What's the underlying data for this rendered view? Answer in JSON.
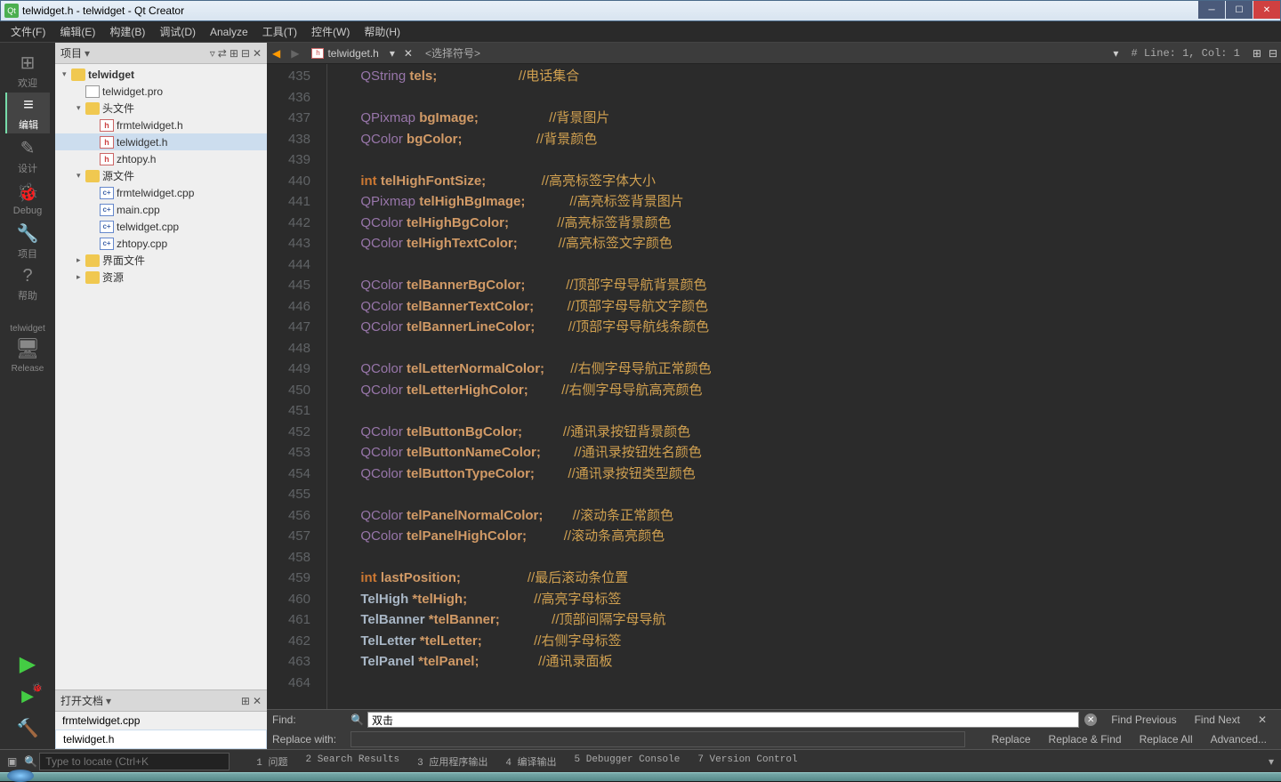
{
  "window": {
    "title": "telwidget.h - telwidget - Qt Creator"
  },
  "menu": [
    "文件(F)",
    "编辑(E)",
    "构建(B)",
    "调试(D)",
    "Analyze",
    "工具(T)",
    "控件(W)",
    "帮助(H)"
  ],
  "iconbar": {
    "items": [
      {
        "icon": "⊞",
        "label": "欢迎"
      },
      {
        "icon": "≡",
        "label": "编辑",
        "active": true
      },
      {
        "icon": "✎",
        "label": "设计"
      },
      {
        "icon": "🐞",
        "label": "Debug"
      },
      {
        "icon": "🔧",
        "label": "项目"
      },
      {
        "icon": "?",
        "label": "帮助"
      }
    ],
    "target": "telwidget",
    "release": "Release"
  },
  "sidebar": {
    "header": "项目",
    "tree": [
      {
        "depth": 0,
        "toggle": "▾",
        "icon": "folder",
        "label": "telwidget",
        "bold": true
      },
      {
        "depth": 1,
        "toggle": "",
        "icon": "pro",
        "label": "telwidget.pro"
      },
      {
        "depth": 1,
        "toggle": "▾",
        "icon": "folder",
        "label": "头文件"
      },
      {
        "depth": 2,
        "toggle": "",
        "icon": "h",
        "label": "frmtelwidget.h"
      },
      {
        "depth": 2,
        "toggle": "",
        "icon": "h",
        "label": "telwidget.h",
        "sel": true
      },
      {
        "depth": 2,
        "toggle": "",
        "icon": "h",
        "label": "zhtopy.h"
      },
      {
        "depth": 1,
        "toggle": "▾",
        "icon": "folder",
        "label": "源文件"
      },
      {
        "depth": 2,
        "toggle": "",
        "icon": "cpp",
        "label": "frmtelwidget.cpp"
      },
      {
        "depth": 2,
        "toggle": "",
        "icon": "cpp",
        "label": "main.cpp"
      },
      {
        "depth": 2,
        "toggle": "",
        "icon": "cpp",
        "label": "telwidget.cpp"
      },
      {
        "depth": 2,
        "toggle": "",
        "icon": "cpp",
        "label": "zhtopy.cpp"
      },
      {
        "depth": 1,
        "toggle": "▸",
        "icon": "folder",
        "label": "界面文件"
      },
      {
        "depth": 1,
        "toggle": "▸",
        "icon": "folder",
        "label": "资源"
      }
    ],
    "openfiles": {
      "header": "打开文档",
      "items": [
        "frmtelwidget.cpp",
        "telwidget.h"
      ],
      "sel": 1
    }
  },
  "editor": {
    "filename": "telwidget.h",
    "symbol": "<选择符号>",
    "lineinfo": "#  Line: 1, Col: 1",
    "startLine": 435,
    "lines": [
      {
        "t": "QString",
        "v": "tels;",
        "c": "//电话集合"
      },
      {
        "blank": true
      },
      {
        "t": "QPixmap",
        "v": "bgImage;",
        "c": "//背景图片"
      },
      {
        "t": "QColor",
        "v": "bgColor;",
        "c": "//背景颜色"
      },
      {
        "blank": true
      },
      {
        "t": "int",
        "kw": true,
        "v": "telHighFontSize;",
        "c": "//高亮标签字体大小"
      },
      {
        "t": "QPixmap",
        "v": "telHighBgImage;",
        "c": "//高亮标签背景图片"
      },
      {
        "t": "QColor",
        "v": "telHighBgColor;",
        "c": "//高亮标签背景颜色"
      },
      {
        "t": "QColor",
        "v": "telHighTextColor;",
        "c": "//高亮标签文字颜色"
      },
      {
        "blank": true
      },
      {
        "t": "QColor",
        "v": "telBannerBgColor;",
        "c": "//顶部字母导航背景颜色"
      },
      {
        "t": "QColor",
        "v": "telBannerTextColor;",
        "c": "//顶部字母导航文字颜色"
      },
      {
        "t": "QColor",
        "v": "telBannerLineColor;",
        "c": "//顶部字母导航线条颜色"
      },
      {
        "blank": true
      },
      {
        "t": "QColor",
        "v": "telLetterNormalColor;",
        "c": "//右侧字母导航正常颜色"
      },
      {
        "t": "QColor",
        "v": "telLetterHighColor;",
        "c": "//右侧字母导航高亮颜色"
      },
      {
        "blank": true
      },
      {
        "t": "QColor",
        "v": "telButtonBgColor;",
        "c": "//通讯录按钮背景颜色"
      },
      {
        "t": "QColor",
        "v": "telButtonNameColor;",
        "c": "//通讯录按钮姓名颜色"
      },
      {
        "t": "QColor",
        "v": "telButtonTypeColor;",
        "c": "//通讯录按钮类型颜色"
      },
      {
        "blank": true
      },
      {
        "t": "QColor",
        "v": "telPanelNormalColor;",
        "c": "//滚动条正常颜色"
      },
      {
        "t": "QColor",
        "v": "telPanelHighColor;",
        "c": "//滚动条高亮颜色"
      },
      {
        "blank": true
      },
      {
        "t": "int",
        "kw": true,
        "v": "lastPosition;",
        "c": "//最后滚动条位置"
      },
      {
        "t": "TelHigh",
        "custom": true,
        "v": "*telHigh;",
        "c": "//高亮字母标签"
      },
      {
        "t": "TelBanner",
        "custom": true,
        "v": "*telBanner;",
        "c": "//顶部间隔字母导航"
      },
      {
        "t": "TelLetter",
        "custom": true,
        "v": "*telLetter;",
        "c": "//右侧字母标签"
      },
      {
        "t": "TelPanel",
        "custom": true,
        "v": "*telPanel;",
        "c": "//通讯录面板"
      },
      {
        "blank": true
      }
    ]
  },
  "find": {
    "findLabel": "Find:",
    "replaceLabel": "Replace with:",
    "value": "双击",
    "buttons": [
      "Find Previous",
      "Find Next",
      "Replace",
      "Replace & Find",
      "Replace All",
      "Advanced..."
    ]
  },
  "bottom": {
    "placeholder": "Type to locate (Ctrl+K",
    "tabs": [
      "1  问题",
      "2  Search Results",
      "3  应用程序输出",
      "4  编译输出",
      "5  Debugger Console",
      "7  Version Control"
    ]
  }
}
